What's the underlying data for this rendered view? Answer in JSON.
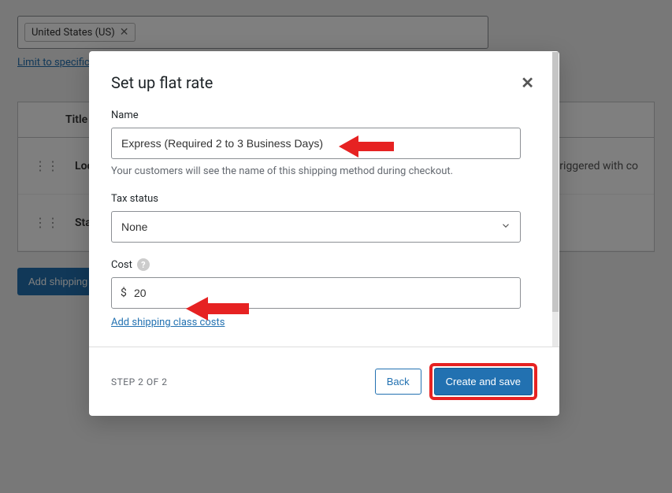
{
  "background": {
    "zone_tag": "United States (US)",
    "limit_link": "Limit to specific",
    "table": {
      "header_title": "Title",
      "rows": [
        {
          "title": "Local",
          "desc_suffix": "an be triggered with co"
        },
        {
          "title": "Stand"
        }
      ]
    },
    "add_shipping_btn": "Add shipping"
  },
  "modal": {
    "title": "Set up flat rate",
    "name": {
      "label": "Name",
      "value": "Express (Required 2 to 3 Business Days)",
      "help": "Your customers will see the name of this shipping method during checkout."
    },
    "tax_status": {
      "label": "Tax status",
      "value": "None"
    },
    "cost": {
      "label": "Cost",
      "prefix": "$",
      "value": "20",
      "add_class_link": "Add shipping class costs"
    },
    "footer": {
      "step": "STEP 2 OF 2",
      "back": "Back",
      "save": "Create and save"
    }
  }
}
